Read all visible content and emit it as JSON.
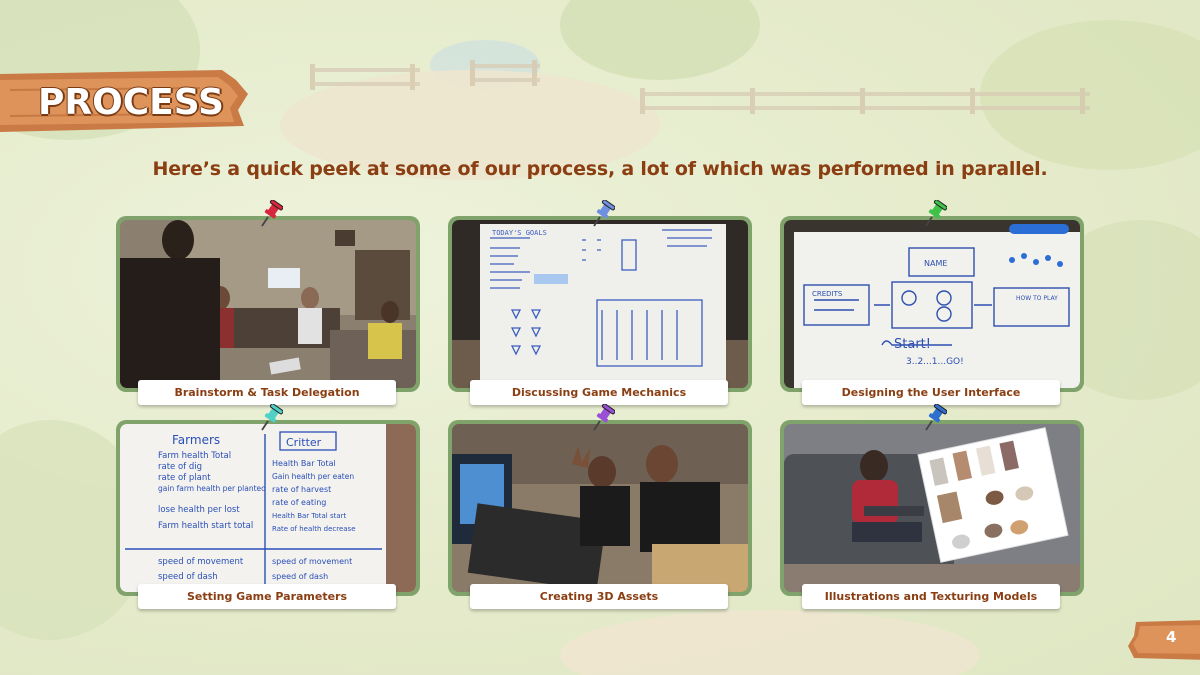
{
  "header": {
    "title": "PROCESS"
  },
  "subtitle": "Here’s a quick peek at some of our process, a lot of which was performed in parallel.",
  "cards": [
    {
      "caption": "Brainstorm & Task Delegation",
      "pin_color": "#d7263d"
    },
    {
      "caption": "Discussing Game Mechanics",
      "pin_color": "#6f8fe0"
    },
    {
      "caption": "Designing the User Interface",
      "pin_color": "#3fc24a"
    },
    {
      "caption": "Setting Game Parameters",
      "pin_color": "#4fd1c7"
    },
    {
      "caption": "Creating 3D Assets",
      "pin_color": "#9a4fd6"
    },
    {
      "caption": "Illustrations and Texturing Models",
      "pin_color": "#2f6fd0"
    }
  ],
  "whiteboard_notes": {
    "goals_heading": "TODAY'S GOALS",
    "start_text": "Start!",
    "countdown_text": "3..2...1...GO!",
    "name_box": "NAME",
    "credits_box": "CREDITS",
    "how_to_play": "HOW TO PLAY",
    "farmers_heading": "Farmers",
    "critter_heading": "Critter",
    "farmers_lines": [
      "Farm health Total",
      "rate of dig",
      "rate of plant",
      "gain farm health per planted",
      "lose health per lost",
      "Farm health start total",
      "speed of movement",
      "speed of dash"
    ],
    "critter_lines": [
      "Health Bar Total",
      "Gain health per eaten",
      "rate of harvest",
      "rate of eating",
      "Health Bar Total start",
      "Rate of health decrease",
      "speed of movement",
      "speed of dash"
    ]
  },
  "page_number": "4"
}
